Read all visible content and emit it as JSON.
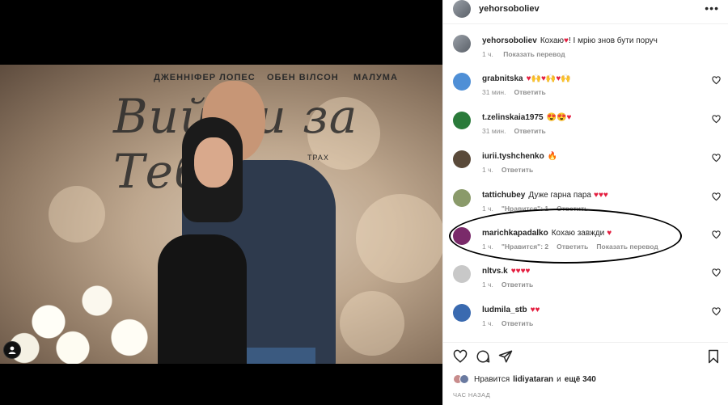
{
  "post": {
    "author": "yehorsoboliev",
    "more_icon": "ellipsis-icon",
    "photo": {
      "backdrop_names": [
        "ДЖЕННІФЕР ЛОПЕС",
        "ОБЕН ВІЛСОН",
        "МАЛУМА"
      ],
      "backdrop_title": "Вийти за Тебе",
      "backdrop_small": "ТРАХ"
    },
    "caption": {
      "user": "yehorsoboliev",
      "text": "Кохаю",
      "text_after": "! І мрію знов бути поруч",
      "time": "1 ч.",
      "translate": "Показать перевод"
    }
  },
  "comments": [
    {
      "user": "grabnitska",
      "text": "",
      "emoji": "♥🙌♥🙌♥🙌",
      "time": "31 мин.",
      "reply": "Ответить",
      "likes": "",
      "translate": "",
      "avatar_color": "#4f8fd6"
    },
    {
      "user": "t.zelinskaia1975",
      "text": "",
      "emoji": "😍😍♥",
      "time": "31 мин.",
      "reply": "Ответить",
      "likes": "",
      "translate": "",
      "avatar_color": "#2a7a3a"
    },
    {
      "user": "iurii.tyshchenko",
      "text": "",
      "emoji": "🔥",
      "time": "1 ч.",
      "reply": "Ответить",
      "likes": "",
      "translate": "",
      "avatar_color": "#5a4a3a"
    },
    {
      "user": "tattichubey",
      "text": "Дуже гарна пара",
      "emoji": "♥♥♥",
      "time": "1 ч.",
      "reply": "Ответить",
      "likes": "\"Нравится\": 1",
      "translate": "",
      "avatar_color": "#8a9a6a"
    },
    {
      "user": "marichkapadalko",
      "text": "Кохаю завжди",
      "emoji": "♥",
      "time": "1 ч.",
      "reply": "Ответить",
      "likes": "\"Нравится\": 2",
      "translate": "Показать перевод",
      "avatar_color": "#7a2a6a"
    },
    {
      "user": "nltvs.k",
      "text": "",
      "emoji": "♥♥♥♥",
      "time": "1 ч.",
      "reply": "Ответить",
      "likes": "",
      "translate": "",
      "avatar_color": "#c8c8c8"
    },
    {
      "user": "ludmila_stb",
      "text": "",
      "emoji": "♥♥",
      "time": "1 ч.",
      "reply": "Ответить",
      "likes": "",
      "translate": "",
      "avatar_color": "#3a6ab0"
    }
  ],
  "footer": {
    "liked_by_prefix": "Нравится",
    "liked_by_user": "lidiyataran",
    "liked_by_and": "и",
    "liked_by_count": "ещё 340",
    "timestamp": "ЧАС НАЗАД"
  },
  "colors": {
    "heart_red": "#e41e3f",
    "text": "#262626",
    "muted": "#8e8e8e"
  }
}
